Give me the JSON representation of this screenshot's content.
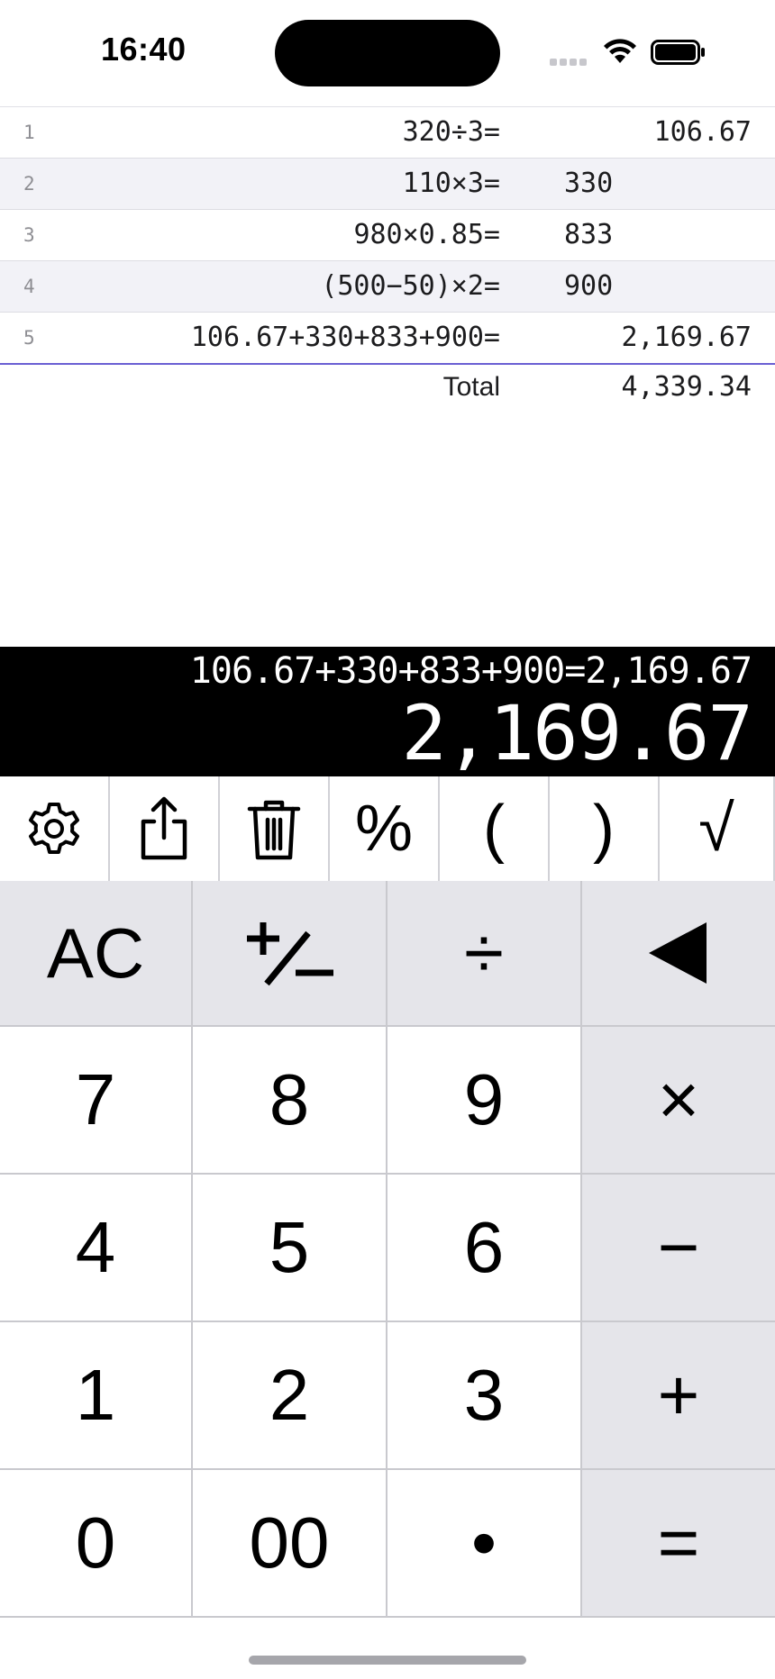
{
  "status": {
    "time": "16:40"
  },
  "tape": {
    "rows": [
      {
        "num": "1",
        "expr": "320÷3=",
        "result": "106.67"
      },
      {
        "num": "2",
        "expr": "110×3=",
        "result": "330"
      },
      {
        "num": "3",
        "expr": "980×0.85=",
        "result": "833"
      },
      {
        "num": "4",
        "expr": "(500−50)×2=",
        "result": "900"
      },
      {
        "num": "5",
        "expr": "106.67+330+833+900=",
        "result": "2,169.67"
      }
    ],
    "total_label": "Total",
    "total_value": "4,339.34"
  },
  "display": {
    "expression": "106.67+330+833+900=",
    "expression_result": "2,169.67",
    "value": "2,169.67"
  },
  "functions": {
    "settings_icon": "gear-icon",
    "share_icon": "share-icon",
    "delete_icon": "trash-icon",
    "percent": "%",
    "open_paren": "(",
    "close_paren": ")",
    "sqrt": "√"
  },
  "keys": {
    "ac": "AC",
    "plus_minus": "+/−",
    "divide": "÷",
    "backspace": "◀",
    "seven": "7",
    "eight": "8",
    "nine": "9",
    "multiply": "×",
    "four": "4",
    "five": "5",
    "six": "6",
    "minus": "−",
    "one": "1",
    "two": "2",
    "three": "3",
    "plus": "+",
    "zero": "0",
    "double_zero": "00",
    "decimal": "•",
    "equals": "="
  }
}
